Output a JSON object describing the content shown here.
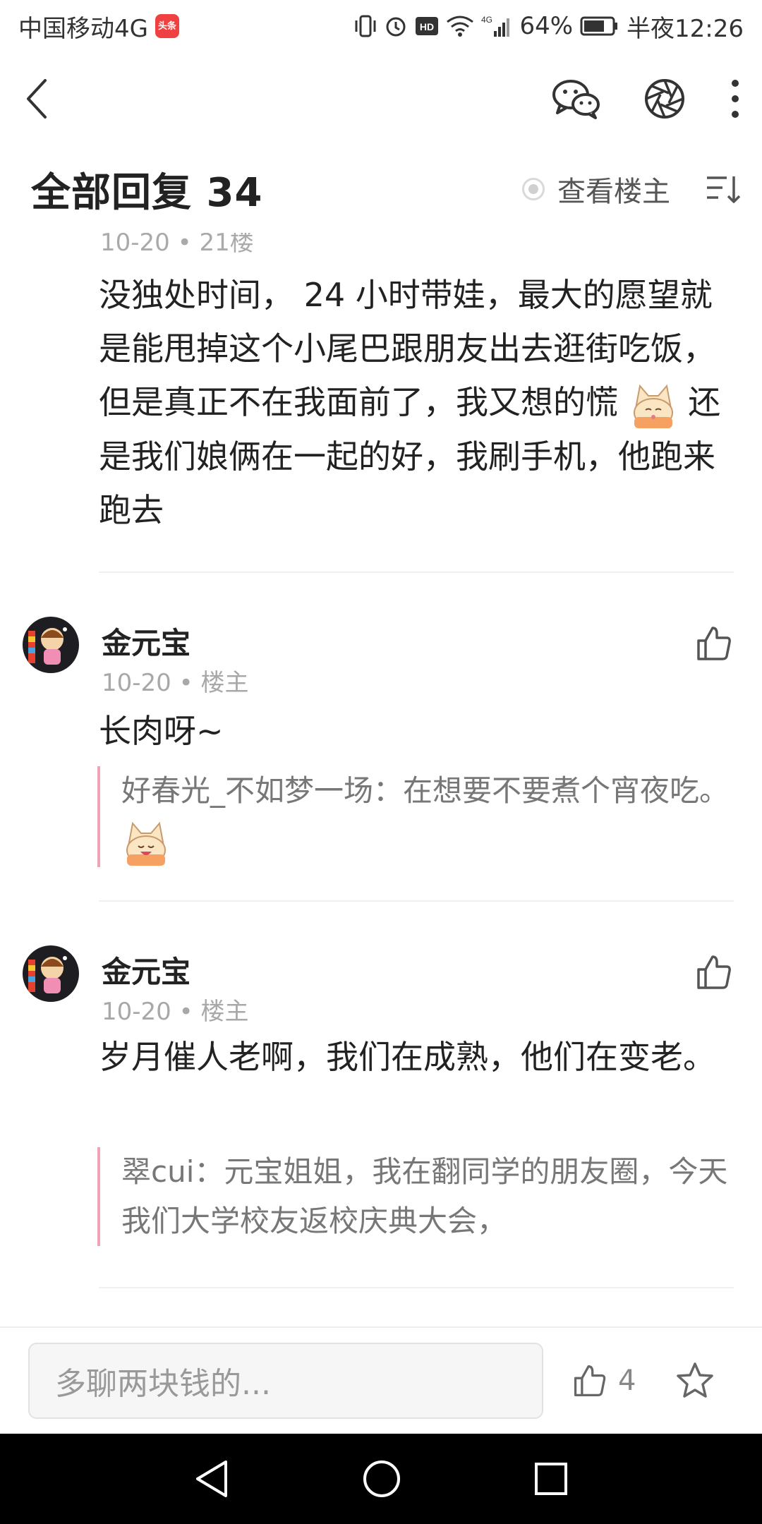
{
  "status_bar": {
    "carrier": "中国移动4G",
    "app_badge": "头条",
    "network": "4G",
    "battery": "64%",
    "time": "半夜12:26"
  },
  "nav": {
    "back_icon": "chevron-left-icon",
    "wechat_icon": "wechat-icon",
    "moments_icon": "aperture-icon",
    "more_icon": "more-vertical-icon"
  },
  "header": {
    "title": "全部回复 34",
    "view_op_label": "查看楼主",
    "sort_icon": "sort-icon"
  },
  "partial_comment": {
    "meta": "10-20 • 21楼",
    "text_before_emoji": "没独处时间， 24 小时带娃，最大的愿望就是能甩掉这个小尾巴跟朋友出去逛街吃饭，但是真正不在我面前了，我又想的慌",
    "text_after_emoji": "还是我们娘俩在一起的好，我刷手机，他跑来跑去"
  },
  "comments": [
    {
      "author": "金元宝",
      "meta": "10-20 • 楼主",
      "text": "长肉呀~",
      "quote_author": "好春光_不如梦一场：",
      "quote_text": "在想要不要煮个宵夜吃。"
    },
    {
      "author": "金元宝",
      "meta": "10-20 • 楼主",
      "text": "岁月催人老啊，我们在成熟，他们在变老。",
      "quote_author": "翠cui：",
      "quote_text": "元宝姐姐，我在翻同学的朋友圈，今天我们大学校友返校庆典大会，"
    }
  ],
  "bottom_bar": {
    "input_placeholder": "多聊两块钱的...",
    "like_count": "4",
    "star_icon": "star-icon"
  },
  "system_nav": {
    "back": "triangle-back-icon",
    "home": "circle-home-icon",
    "recent": "square-recent-icon"
  },
  "colors": {
    "quote_bar": "#f0a3b2",
    "text_primary": "#222222",
    "text_meta": "#a8a8a8"
  }
}
